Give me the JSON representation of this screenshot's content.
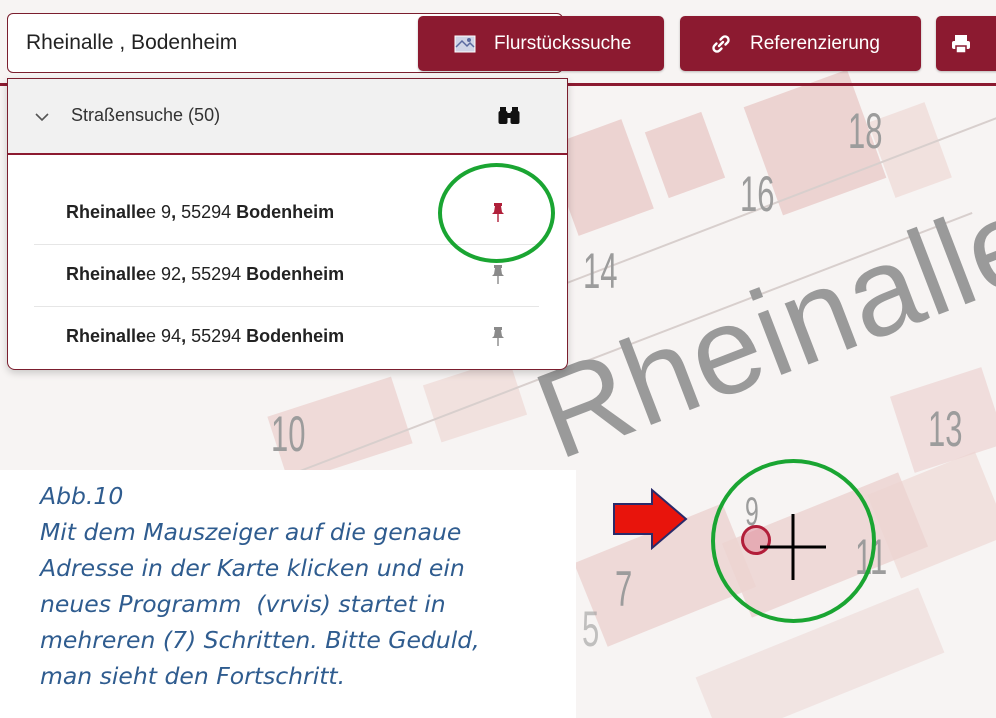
{
  "search": {
    "value": "Rheinalle , Bodenheim"
  },
  "toolbar": {
    "buttons": [
      {
        "label": "Flurstückssuche",
        "icon": "map-search-icon"
      },
      {
        "label": "Referenzierung",
        "icon": "link-icon"
      },
      {
        "label": "",
        "icon": "print-icon"
      }
    ]
  },
  "dropdown": {
    "section_title": "Straßensuche (50)",
    "expand_icon": "chevron-down-icon",
    "search_icon": "binoculars-icon",
    "results": [
      {
        "match": "Rheinalle",
        "rest": "e 9",
        "comma": ",",
        "zip": " 55294 ",
        "city": "Bodenheim",
        "pinned": true
      },
      {
        "match": "Rheinalle",
        "rest": "e 92",
        "comma": ",",
        "zip": " 55294 ",
        "city": "Bodenheim",
        "pinned": false
      },
      {
        "match": "Rheinalle",
        "rest": "e 94",
        "comma": ",",
        "zip": " 55294 ",
        "city": "Bodenheim",
        "pinned": false
      }
    ]
  },
  "map": {
    "street_label": "Rheinallee",
    "house_numbers": [
      "18",
      "16",
      "14",
      "10",
      "13",
      "9",
      "11",
      "7",
      "5"
    ]
  },
  "annotation": {
    "title": "Abb.10",
    "lines": [
      "Mit dem Mauszeiger auf die genaue",
      "Adresse in der Karte klicken und ein",
      "neues Programm  (vrvis) startet in",
      "mehreren (7) Schritten. Bitte Geduld,",
      "man sieht den Fortschritt."
    ]
  },
  "colors": {
    "brand": "#8c1a30",
    "annotation_text": "#2f5c8f",
    "highlight_ring": "#1aa532",
    "arrow": "#e8140c",
    "pin_active": "#b0203a",
    "pin_inactive": "#8a8a8a"
  }
}
